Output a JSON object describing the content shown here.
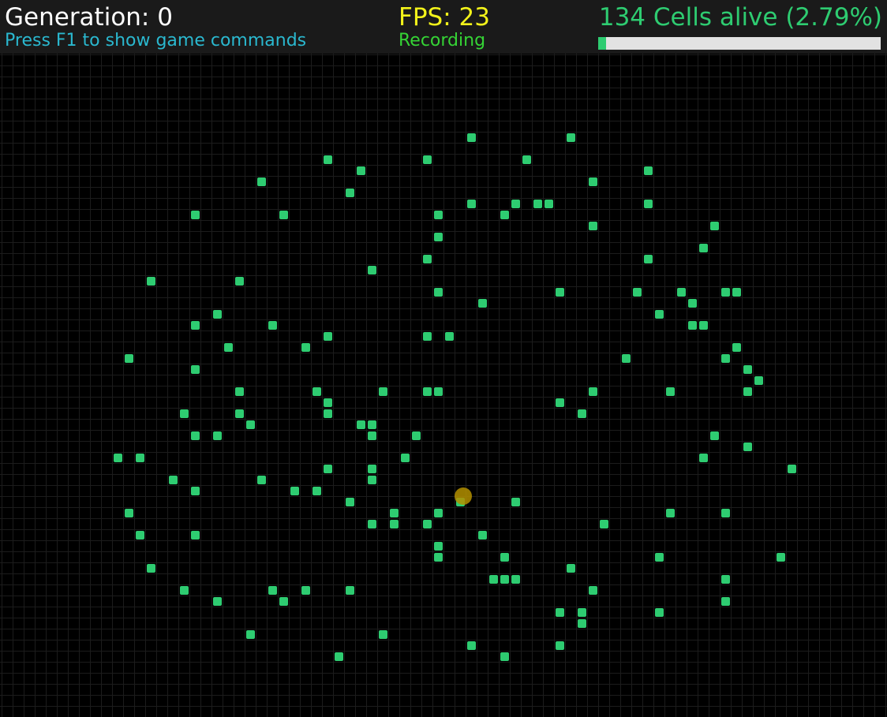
{
  "hud": {
    "generation": "Generation: 0",
    "hint": "Press F1 to show game commands",
    "fps": "FPS: 23",
    "status": "Recording",
    "alive": "134 Cells alive (2.79%)",
    "alive_fraction": 0.0279
  },
  "colors": {
    "background": "#000000",
    "hud_background": "#1a1a1a",
    "grid_line": "#1c1c1c",
    "cell": "#2ecc71",
    "cursor": "#b38f00",
    "progress_track": "#e2e2e2"
  },
  "board": {
    "columns": 80,
    "rows": 60,
    "cells": [
      [
        42,
        7
      ],
      [
        51,
        7
      ],
      [
        29,
        9
      ],
      [
        38,
        9
      ],
      [
        47,
        9
      ],
      [
        32,
        10
      ],
      [
        58,
        10
      ],
      [
        23,
        11
      ],
      [
        53,
        11
      ],
      [
        31,
        12
      ],
      [
        42,
        13
      ],
      [
        46,
        13
      ],
      [
        48,
        13
      ],
      [
        49,
        13
      ],
      [
        58,
        13
      ],
      [
        17,
        14
      ],
      [
        25,
        14
      ],
      [
        39,
        14
      ],
      [
        45,
        14
      ],
      [
        53,
        15
      ],
      [
        64,
        15
      ],
      [
        39,
        16
      ],
      [
        63,
        17
      ],
      [
        38,
        18
      ],
      [
        58,
        18
      ],
      [
        33,
        19
      ],
      [
        13,
        20
      ],
      [
        21,
        20
      ],
      [
        39,
        21
      ],
      [
        50,
        21
      ],
      [
        57,
        21
      ],
      [
        61,
        21
      ],
      [
        65,
        21
      ],
      [
        66,
        21
      ],
      [
        43,
        22
      ],
      [
        62,
        22
      ],
      [
        19,
        23
      ],
      [
        59,
        23
      ],
      [
        17,
        24
      ],
      [
        24,
        24
      ],
      [
        62,
        24
      ],
      [
        63,
        24
      ],
      [
        29,
        25
      ],
      [
        38,
        25
      ],
      [
        40,
        25
      ],
      [
        20,
        26
      ],
      [
        27,
        26
      ],
      [
        66,
        26
      ],
      [
        11,
        27
      ],
      [
        56,
        27
      ],
      [
        65,
        27
      ],
      [
        17,
        28
      ],
      [
        67,
        28
      ],
      [
        68,
        29
      ],
      [
        21,
        30
      ],
      [
        28,
        30
      ],
      [
        34,
        30
      ],
      [
        38,
        30
      ],
      [
        39,
        30
      ],
      [
        53,
        30
      ],
      [
        60,
        30
      ],
      [
        67,
        30
      ],
      [
        29,
        31
      ],
      [
        50,
        31
      ],
      [
        16,
        32
      ],
      [
        21,
        32
      ],
      [
        29,
        32
      ],
      [
        52,
        32
      ],
      [
        22,
        33
      ],
      [
        32,
        33
      ],
      [
        33,
        33
      ],
      [
        17,
        34
      ],
      [
        19,
        34
      ],
      [
        33,
        34
      ],
      [
        37,
        34
      ],
      [
        64,
        34
      ],
      [
        67,
        35
      ],
      [
        10,
        36
      ],
      [
        12,
        36
      ],
      [
        36,
        36
      ],
      [
        63,
        36
      ],
      [
        29,
        37
      ],
      [
        33,
        37
      ],
      [
        71,
        37
      ],
      [
        15,
        38
      ],
      [
        23,
        38
      ],
      [
        33,
        38
      ],
      [
        17,
        39
      ],
      [
        26,
        39
      ],
      [
        28,
        39
      ],
      [
        31,
        40
      ],
      [
        41,
        40
      ],
      [
        46,
        40
      ],
      [
        11,
        41
      ],
      [
        35,
        41
      ],
      [
        39,
        41
      ],
      [
        60,
        41
      ],
      [
        65,
        41
      ],
      [
        33,
        42
      ],
      [
        35,
        42
      ],
      [
        38,
        42
      ],
      [
        54,
        42
      ],
      [
        12,
        43
      ],
      [
        17,
        43
      ],
      [
        43,
        43
      ],
      [
        39,
        44
      ],
      [
        39,
        45
      ],
      [
        45,
        45
      ],
      [
        59,
        45
      ],
      [
        70,
        45
      ],
      [
        13,
        46
      ],
      [
        51,
        46
      ],
      [
        44,
        47
      ],
      [
        45,
        47
      ],
      [
        46,
        47
      ],
      [
        65,
        47
      ],
      [
        16,
        48
      ],
      [
        24,
        48
      ],
      [
        27,
        48
      ],
      [
        31,
        48
      ],
      [
        53,
        48
      ],
      [
        19,
        49
      ],
      [
        25,
        49
      ],
      [
        65,
        49
      ],
      [
        50,
        50
      ],
      [
        52,
        50
      ],
      [
        59,
        50
      ],
      [
        52,
        51
      ],
      [
        22,
        52
      ],
      [
        34,
        52
      ],
      [
        42,
        53
      ],
      [
        50,
        53
      ],
      [
        30,
        54
      ],
      [
        45,
        54
      ]
    ],
    "cursor": [
      41,
      40
    ]
  }
}
